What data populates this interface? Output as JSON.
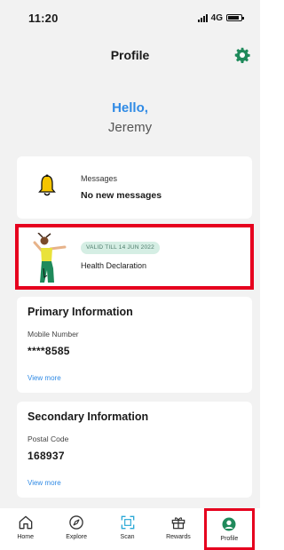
{
  "status_bar": {
    "time": "11:20",
    "network": "4G"
  },
  "header": {
    "title": "Profile",
    "settings_icon": "gear-icon"
  },
  "greeting": {
    "hello": "Hello,",
    "name": "Jeremy"
  },
  "messages": {
    "label": "Messages",
    "value": "No new messages",
    "icon": "bell-icon"
  },
  "health": {
    "badge": "VALID TILL 14 JUN 2022",
    "title": "Health Declaration",
    "icon": "health-figure-icon"
  },
  "primary": {
    "title": "Primary Information",
    "label": "Mobile Number",
    "value": "****8585",
    "link": "View more"
  },
  "secondary": {
    "title": "Secondary Information",
    "label": "Postal Code",
    "value": "168937",
    "link": "View more"
  },
  "nav": {
    "items": [
      {
        "label": "Home",
        "icon": "home-icon"
      },
      {
        "label": "Explore",
        "icon": "compass-icon"
      },
      {
        "label": "Scan",
        "icon": "scan-icon"
      },
      {
        "label": "Rewards",
        "icon": "gift-icon"
      },
      {
        "label": "Profile",
        "icon": "profile-icon",
        "active": true
      }
    ]
  },
  "colors": {
    "accent": "#2f8ae5",
    "highlight": "#e6001e",
    "brand_green": "#1f8a5b"
  }
}
